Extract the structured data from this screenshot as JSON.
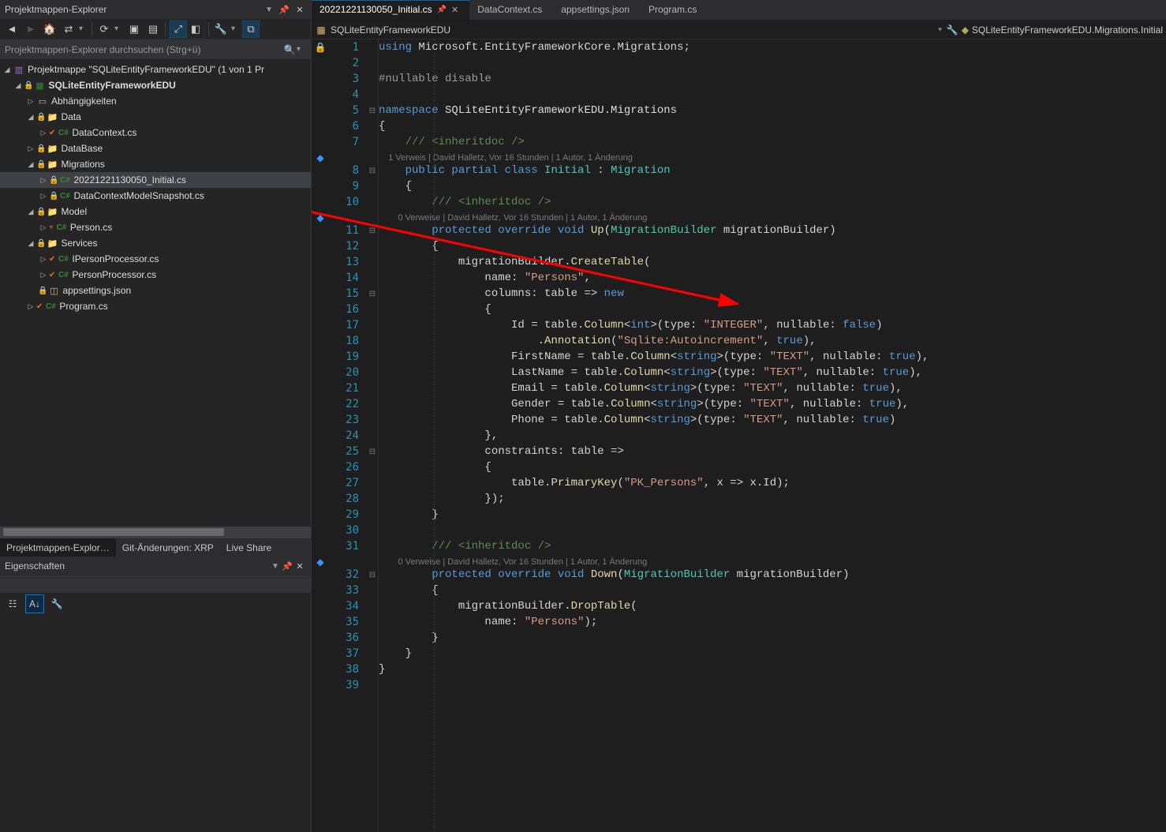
{
  "explorer": {
    "title": "Projektmappen-Explorer",
    "search_placeholder": "Projektmappen-Explorer durchsuchen (Strg+ü)",
    "nodes": {
      "solution": "Projektmappe \"SQLiteEntityFrameworkEDU\" (1 von 1 Pr",
      "project": "SQLiteEntityFrameworkEDU",
      "dependencies": "Abhängigkeiten",
      "data": "Data",
      "datacontext": "DataContext.cs",
      "database": "DataBase",
      "migrations": "Migrations",
      "initial": "20221221130050_Initial.cs",
      "snapshot": "DataContextModelSnapshot.cs",
      "model": "Model",
      "person": "Person.cs",
      "services": "Services",
      "ipersonproc": "IPersonProcessor.cs",
      "personproc": "PersonProcessor.cs",
      "appsettings": "appsettings.json",
      "program": "Program.cs"
    },
    "csharp_badge": "C#"
  },
  "bottom_tabs": {
    "t1": "Projektmappen-Explor…",
    "t2": "Git-Änderungen: XRP",
    "t3": "Live Share"
  },
  "properties": {
    "title": "Eigenschaften"
  },
  "editor_tabs": {
    "t1": "20221221130050_Initial.cs",
    "t2": "DataContext.cs",
    "t3": "appsettings.json",
    "t4": "Program.cs"
  },
  "crumb": {
    "left": "SQLiteEntityFrameworkEDU",
    "right": "SQLiteEntityFrameworkEDU.Migrations.Initial"
  },
  "codelens": {
    "l1": "1 Verweis | David Halletz, Vor 16 Stunden | 1 Autor, 1 Änderung",
    "l2": "0 Verweise | David Halletz, Vor 16 Stunden | 1 Autor, 1 Änderung",
    "l3": "0 Verweise | David Halletz, Vor 16 Stunden | 1 Autor, 1 Änderung"
  },
  "code": {
    "l1a": "using",
    "l1b": " Microsoft.EntityFrameworkCore.Migrations;",
    "l3a": "#nullable disable",
    "l5a": "namespace",
    "l5b": " SQLiteEntityFrameworkEDU.Migrations",
    "l6": "{",
    "l7": "    /// <inheritdoc />",
    "l8a": "    public partial class ",
    "l8b": "Initial",
    "l8c": " : ",
    "l8d": "Migration",
    "l9": "    {",
    "l10": "        /// <inheritdoc />",
    "l11a": "        protected override void ",
    "l11b": "Up",
    "l11c": "(",
    "l11d": "MigrationBuilder",
    "l11e": " migrationBuilder)",
    "l12": "        {",
    "l13a": "            migrationBuilder.",
    "l13b": "CreateTable",
    "l13c": "(",
    "l14a": "                name: ",
    "l14b": "\"Persons\"",
    "l14c": ",",
    "l15a": "                columns: table => ",
    "l15b": "new",
    "l16": "                {",
    "l17a": "                    Id = table.",
    "l17b": "Column",
    "l17c": "<",
    "l17d": "int",
    "l17e": ">(type: ",
    "l17f": "\"INTEGER\"",
    "l17g": ", nullable: ",
    "l17h": "false",
    "l17i": ")",
    "l18a": "                        .",
    "l18b": "Annotation",
    "l18c": "(",
    "l18d": "\"Sqlite:Autoincrement\"",
    "l18e": ", ",
    "l18f": "true",
    "l18g": "),",
    "l19a": "                    FirstName = table.",
    "l19b": "Column",
    "l19c": "<",
    "l19d": "string",
    "l19e": ">(type: ",
    "l19f": "\"TEXT\"",
    "l19g": ", nullable: ",
    "l19h": "true",
    "l19i": "),",
    "l20a": "                    LastName = table.",
    "l20b": "Column",
    "l20c": "<",
    "l20d": "string",
    "l20e": ">(type: ",
    "l20f": "\"TEXT\"",
    "l20g": ", nullable: ",
    "l20h": "true",
    "l20i": "),",
    "l21a": "                    Email = table.",
    "l21b": "Column",
    "l21c": "<",
    "l21d": "string",
    "l21e": ">(type: ",
    "l21f": "\"TEXT\"",
    "l21g": ", nullable: ",
    "l21h": "true",
    "l21i": "),",
    "l22a": "                    Gender = table.",
    "l22b": "Column",
    "l22c": "<",
    "l22d": "string",
    "l22e": ">(type: ",
    "l22f": "\"TEXT\"",
    "l22g": ", nullable: ",
    "l22h": "true",
    "l22i": "),",
    "l23a": "                    Phone = table.",
    "l23b": "Column",
    "l23c": "<",
    "l23d": "string",
    "l23e": ">(type: ",
    "l23f": "\"TEXT\"",
    "l23g": ", nullable: ",
    "l23h": "true",
    "l23i": ")",
    "l24": "                },",
    "l25a": "                constraints: table =>",
    "l26": "                {",
    "l27a": "                    table.",
    "l27b": "PrimaryKey",
    "l27c": "(",
    "l27d": "\"PK_Persons\"",
    "l27e": ", x => x.Id);",
    "l28": "                });",
    "l29": "        }",
    "l31": "        /// <inheritdoc />",
    "l32a": "        protected override void ",
    "l32b": "Down",
    "l32c": "(",
    "l32d": "MigrationBuilder",
    "l32e": " migrationBuilder)",
    "l33": "        {",
    "l34a": "            migrationBuilder.",
    "l34b": "DropTable",
    "l34c": "(",
    "l35a": "                name: ",
    "l35b": "\"Persons\"",
    "l35c": ");",
    "l36": "        }",
    "l37": "    }",
    "l38": "}"
  },
  "linenumbers": [
    "1",
    "2",
    "3",
    "4",
    "5",
    "6",
    "7",
    "",
    "8",
    "9",
    "10",
    "",
    "11",
    "12",
    "13",
    "14",
    "15",
    "16",
    "17",
    "18",
    "19",
    "20",
    "21",
    "22",
    "23",
    "24",
    "25",
    "26",
    "27",
    "28",
    "29",
    "30",
    "31",
    "",
    "32",
    "33",
    "34",
    "35",
    "36",
    "37",
    "38",
    "39"
  ]
}
